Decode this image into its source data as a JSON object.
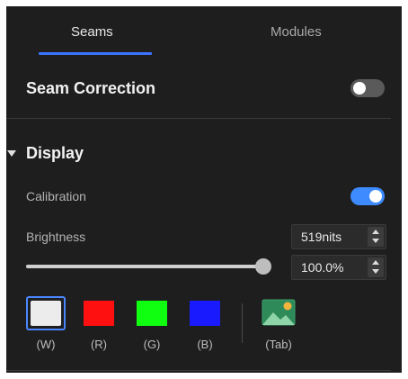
{
  "tabs": [
    {
      "label": "Seams",
      "active": true
    },
    {
      "label": "Modules",
      "active": false
    }
  ],
  "seam_correction": {
    "title": "Seam Correction",
    "enabled": false
  },
  "display": {
    "title": "Display",
    "expanded": true,
    "calibration": {
      "label": "Calibration",
      "enabled": true
    },
    "brightness": {
      "label": "Brightness",
      "nits_value": "519nits",
      "percent_value": "100.0%",
      "slider_level": 1.0
    },
    "color_buttons": [
      {
        "label": "(W)",
        "color": "#ececec",
        "selected": true
      },
      {
        "label": "(R)",
        "color": "#ff1010",
        "selected": false
      },
      {
        "label": "(G)",
        "color": "#10ff10",
        "selected": false
      },
      {
        "label": "(B)",
        "color": "#1a1aff",
        "selected": false
      }
    ],
    "image_button": {
      "label": "(Tab)",
      "icon": "image-icon"
    }
  },
  "colors": {
    "accent": "#3b74ff",
    "toggle_on": "#3d8bff",
    "toggle_off": "#5a5a5a",
    "panel_bg": "#1e1e1e"
  }
}
